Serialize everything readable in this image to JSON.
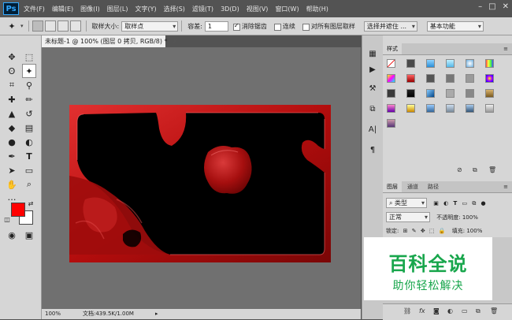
{
  "app": {
    "logo_text": "Ps"
  },
  "menu": {
    "items": [
      "文件(F)",
      "编辑(E)",
      "图像(I)",
      "图层(L)",
      "文字(Y)",
      "选择(S)",
      "滤镜(T)",
      "3D(D)",
      "视图(V)",
      "窗口(W)",
      "帮助(H)"
    ]
  },
  "window_controls": {
    "minimize": "–",
    "maximize": "□",
    "close": "✕"
  },
  "options": {
    "sample_size_label": "取样大小:",
    "sample_size_value": "取样点",
    "tolerance_label": "容差:",
    "tolerance_value": "1",
    "antialias_label": "消除锯齿",
    "antialias_checked": true,
    "contiguous_label": "连续",
    "contiguous_checked": false,
    "all_layers_label": "对所有图层取样",
    "all_layers_checked": false,
    "select_mask_button": "选择并遮住 ...",
    "workspace_value": "基本功能"
  },
  "document": {
    "tab_title": "未标题-1 @ 100% (图层 0 拷贝, RGB/8) *",
    "close_glyph": "✕",
    "zoom": "100%",
    "doc_info": "文档:439.5K/1.00M"
  },
  "colors": {
    "foreground": "#ff0000",
    "background": "#ffffff",
    "accent": "#18a64c"
  },
  "styles_panel": {
    "tab_label": "样式",
    "menu_glyph": "≡"
  },
  "layers_panel": {
    "tabs": [
      "图层",
      "通道",
      "路径"
    ],
    "kind_label": "类型",
    "blend_mode": "正常",
    "opacity_label": "不透明度:",
    "opacity_value": "100%",
    "lock_label": "锁定:",
    "fill_label": "填充:",
    "fill_value": "100%"
  },
  "watermark": {
    "title": "百科全说",
    "subtitle": "助你轻松解决"
  },
  "icons": {
    "magic-wand": "✦",
    "move": "✥",
    "marquee": "⬚",
    "lasso": "ʘ",
    "quick-select": "✎",
    "crop": "⌗",
    "eyedropper": "⚲",
    "healing": "✚",
    "brush": "✏",
    "stamp": "▲",
    "history": "↺",
    "eraser": "◆",
    "gradient": "▤",
    "blur": "●",
    "dodge": "◐",
    "pen": "✒",
    "type": "T",
    "path-select": "➤",
    "shape": "▭",
    "hand": "✋",
    "zoom": "⌕",
    "more": "…",
    "swap": "⇄",
    "reset": "◫",
    "quickmask": "◉",
    "screen": "▣"
  }
}
